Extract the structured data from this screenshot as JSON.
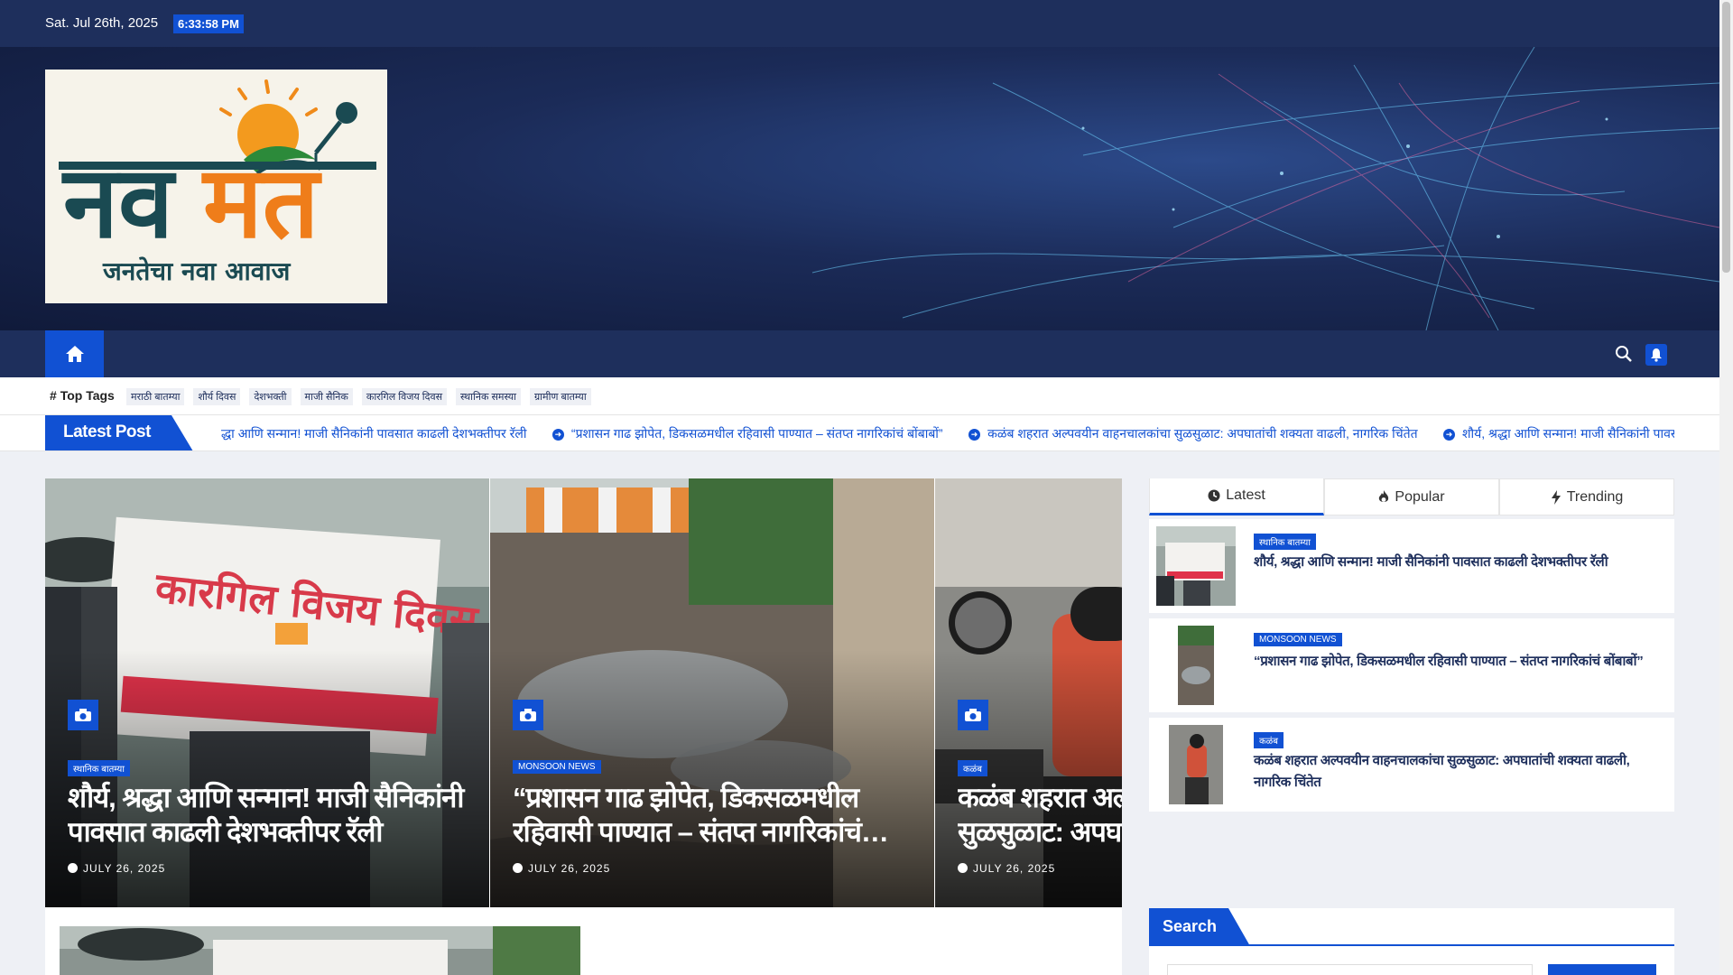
{
  "topbar": {
    "date": "Sat. Jul 26th, 2025",
    "time": "6:33:58 PM"
  },
  "logo": {
    "brand_left": "नव",
    "brand_right": "मत",
    "tagline": "जनतेचा नवा आवाज"
  },
  "nav": {
    "home_icon": "home-icon",
    "search_icon": "search-icon",
    "bell_icon": "bell-icon"
  },
  "top_tags": {
    "title": "Top Tags",
    "tags": [
      "मराठी बातम्या",
      "शौर्य दिवस",
      "देशभक्ती",
      "माजी सैनिक",
      "कारगिल विजय दिवस",
      "स्थानिक समस्या",
      "ग्रामीण बातम्या"
    ]
  },
  "latest_post": {
    "label": "Latest Post",
    "items": [
      "द्धा आणि सन्मान! माजी सैनिकांनी पावसात काढली देशभक्तीपर रॅली",
      "“प्रशासन गाढ झोपेत, डिकसळमधील रहिवासी पाण्यात – संतप्त नागरिकांचं बोंबाबों”",
      "कळंब शहरात अल्पवयीन वाहनचालकांचा सुळसुळाट: अपघातांची शक्यता वाढली, नागरिक चिंतेत",
      "शौर्य, श्रद्धा आणि सन्मान! माजी सैनिकांनी पावसात काढली दे"
    ]
  },
  "slides": [
    {
      "category": "स्थानिक बातम्या",
      "title": "शौर्य, श्रद्धा आणि सन्मान! माजी सैनिकांनी पावसात काढली देशभक्तीपर रॅली",
      "date": "JULY 26, 2025"
    },
    {
      "category": "MONSOON NEWS",
      "title": "“प्रशासन गाढ झोपेत, डिकसळमधील रहिवासी पाण्यात – संतप्त नागरिकांचं…",
      "date": "JULY 26, 2025"
    },
    {
      "category": "कळंब",
      "title": "कळंब शहरात अल्पवयीन वाहनचालकांचा सुळसुळाट: अपघातांची शक्यता",
      "date": "JULY 26, 2025"
    }
  ],
  "sidebar": {
    "tabs": [
      {
        "label": "Latest",
        "icon": "clock-icon"
      },
      {
        "label": "Popular",
        "icon": "fire-icon"
      },
      {
        "label": "Trending",
        "icon": "bolt-icon"
      }
    ],
    "posts": [
      {
        "category": "स्थानिक बातम्या",
        "title": "शौर्य, श्रद्धा आणि सन्मान! माजी सैनिकांनी पावसात काढली देशभक्तीपर रॅली"
      },
      {
        "category": "MONSOON NEWS",
        "title": "“प्रशासन गाढ झोपेत, डिकसळमधील रहिवासी पाण्यात – संतप्त नागरिकांचं बोंबाबों”"
      },
      {
        "category": "कळंब",
        "title": "कळंब शहरात अल्पवयीन वाहनचालकांचा सुळसुळाट: अपघातांची शक्यता वाढली, नागरिक चिंतेत"
      }
    ],
    "search_title": "Search"
  },
  "colors": {
    "navy": "#1e2f5c",
    "accent": "#1151d3",
    "orange": "#ef7d1a",
    "teal": "#1a4a52"
  }
}
